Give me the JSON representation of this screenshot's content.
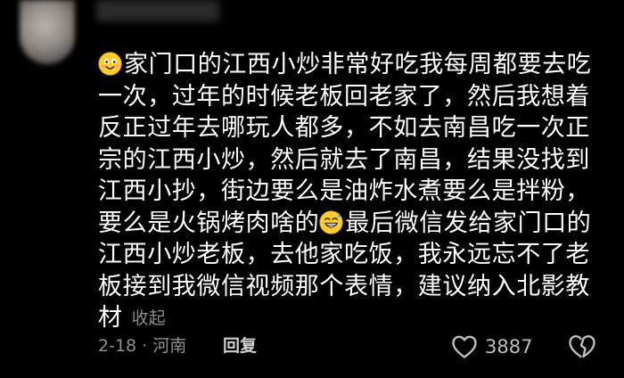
{
  "comment": {
    "lines": [
      "家门口的江西小炒非常好吃我每周都要去吃",
      "一次，过年的时候老板回老家了，然后我想着",
      "反正过年去哪玩人都多，不如去南昌吃一次正",
      "宗的江西小炒，然后就去了南昌，结果没找到",
      "江西小抄，街边要么是油炸水煮要么是拌粉，",
      "要么是火锅烤肉啥的",
      "最后微信发给家门口的",
      "江西小炒老板，去他家吃饭，我永远忘不了老",
      "板接到我微信视频那个表情，建议纳入北影教",
      "材"
    ],
    "collapse_label": "收起"
  },
  "meta": {
    "date_location": "2-18 · 河南",
    "reply_label": "回复",
    "like_count": "3887"
  },
  "icons": {
    "emoji_1": "smiling-face-emoji",
    "emoji_2": "grinning-sweat-emoji",
    "like": "heart-outline-icon",
    "dislike": "broken-heart-icon"
  }
}
